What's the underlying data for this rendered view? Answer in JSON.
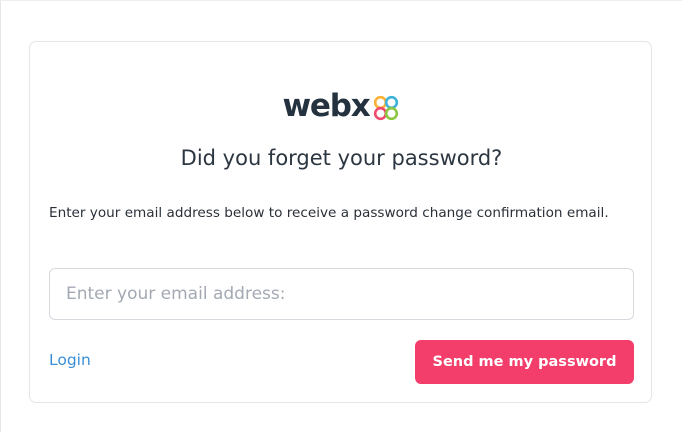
{
  "logo": {
    "text": "webx",
    "icon": "four-petal-clover-logo-icon",
    "colors": [
      "#f9b233",
      "#3bb3d9",
      "#ef4a6b",
      "#8cc63f"
    ]
  },
  "form": {
    "title": "Did you forget your password?",
    "description": "Enter your email address below to receive a password change confirmation email.",
    "email_placeholder": "Enter your email address:",
    "email_value": "",
    "login_label": "Login",
    "submit_label": "Send me my password"
  },
  "colors": {
    "accent": "#f33d6a",
    "link": "#3a8fd8",
    "text": "#2c3640",
    "border": "#e3e5ea"
  }
}
